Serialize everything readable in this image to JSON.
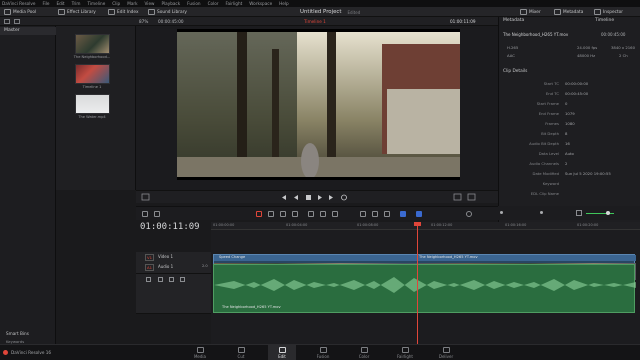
{
  "menu": [
    "DaVinci Resolve",
    "File",
    "Edit",
    "Trim",
    "Timeline",
    "Clip",
    "Mark",
    "View",
    "Playback",
    "Fusion",
    "Color",
    "Fairlight",
    "Workspace",
    "Help"
  ],
  "toolbar": {
    "media_pool": "Media Pool",
    "effects_library": "Effect Library",
    "edit_index": "Edit Index",
    "sound_library": "Sound Library",
    "project_title": "Untitled Project",
    "edited": "Edited",
    "mixer": "Mixer",
    "metadata": "Metadata",
    "inspector": "Inspector"
  },
  "viewer_bar": {
    "zoom": "87%",
    "source_tc": "00:00:45:00",
    "timeline_name": "Timeline 1",
    "record_tc": "01:00:11:09"
  },
  "bin": {
    "master": "Master",
    "clips": [
      "The Neighborhood...",
      "Timeline 1",
      "The Water.mp4"
    ],
    "smart_bins": "Smart Bins",
    "keywords": "Keywords"
  },
  "metadata": {
    "tab_label": "Metadata",
    "tab_timeline": "Timeline",
    "filename": "The Neighborhood_H265 YT.mov",
    "duration": "00:00:45:00",
    "codec": "H.265",
    "fps": "24.000 fps",
    "resolution": "3840 x 2160",
    "audio_codec": "AAC",
    "sample_rate": "48000 Hz",
    "channels": "2 Ch",
    "section": "Clip Details",
    "rows": [
      {
        "k": "Start TC",
        "v": "00:00:00:00"
      },
      {
        "k": "End TC",
        "v": "00:00:45:00"
      },
      {
        "k": "Start Frame",
        "v": "0"
      },
      {
        "k": "End Frame",
        "v": "1079"
      },
      {
        "k": "Frames",
        "v": "1080"
      },
      {
        "k": "Bit Depth",
        "v": "8"
      },
      {
        "k": "Audio Bit Depth",
        "v": "16"
      },
      {
        "k": "Data Level",
        "v": "Auto"
      },
      {
        "k": "Audio Channels",
        "v": "2"
      },
      {
        "k": "Date Modified",
        "v": "Sun Jul 5 2020 19:00:55"
      },
      {
        "k": "Keyword",
        "v": ""
      },
      {
        "k": "EDL Clip Name",
        "v": ""
      }
    ]
  },
  "timeline": {
    "timecode": "01:00:11:09",
    "ruler": [
      "01:00:00:00",
      "01:00:04:00",
      "01:00:08:00",
      "01:00:12:00",
      "01:00:16:00",
      "01:00:20:00"
    ],
    "video_track": {
      "id": "V1",
      "name": "Video 1"
    },
    "audio_track": {
      "id": "A1",
      "name": "Audio 1",
      "level": "2.0"
    },
    "transition": "Speed Change",
    "video_clip": "The Neighborhood_H265 YT.mov",
    "audio_clip": "The Neighborhood_H265 YT.mov"
  },
  "pages": [
    "Media",
    "Cut",
    "Edit",
    "Fusion",
    "Color",
    "Fairlight",
    "Deliver"
  ],
  "app_name": "DaVinci Resolve 16",
  "colors": {
    "accent": "#e0463a",
    "video_clip": "#2c4a6a",
    "audio_clip": "#2a6d3f"
  }
}
